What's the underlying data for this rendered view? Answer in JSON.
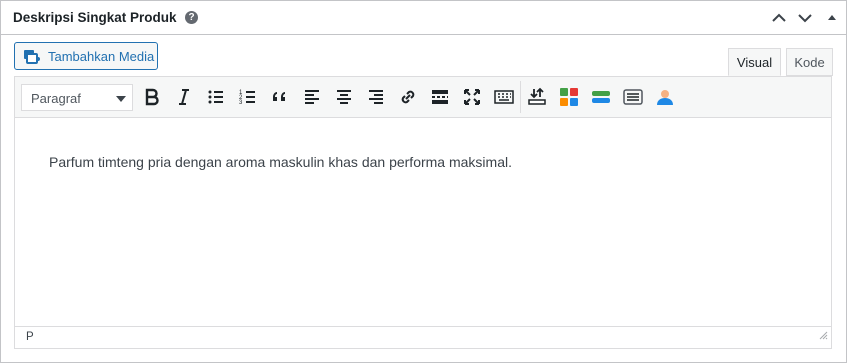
{
  "header": {
    "title": "Deskripsi Singkat Produk",
    "help_glyph": "?"
  },
  "media_button": {
    "label": "Tambahkan Media",
    "icon": "media-icon"
  },
  "tabs": [
    {
      "label": "Visual",
      "active": true
    },
    {
      "label": "Kode",
      "active": false
    }
  ],
  "toolbar": {
    "format_select": {
      "value": "Paragraf"
    },
    "buttons": [
      "bold",
      "italic",
      "bulleted-list",
      "numbered-list",
      "blockquote",
      "align-left",
      "align-center",
      "align-right",
      "insert-link",
      "read-more",
      "fullscreen",
      "toolbar-toggle",
      "import",
      "widgets-grid",
      "form",
      "table",
      "user-upload"
    ]
  },
  "content": {
    "paragraph": "Parfum timteng pria dengan aroma maskulin khas dan performa maksimal."
  },
  "status": {
    "path": "P"
  },
  "colors": {
    "accent": "#2271b1",
    "border": "#c3c4c7",
    "toolbar_bg": "#f6f7f7",
    "text": "#3c434a"
  }
}
